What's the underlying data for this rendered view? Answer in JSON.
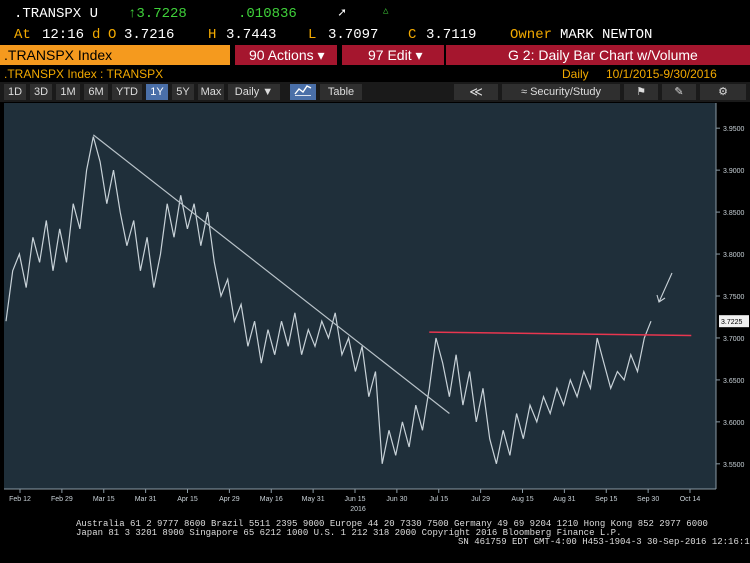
{
  "header": {
    "ticker": ".TRANSPX U",
    "last": "↑3.7228",
    "change": ".010836",
    "at_label": "At",
    "time": "12:16",
    "d_label": "d",
    "open_label": "O",
    "open": "3.7216",
    "high_label": "H",
    "high": "3.7443",
    "low_label": "L",
    "low": "3.7097",
    "close_label": "C",
    "close": "3.7119",
    "owner_label": "Owner",
    "owner": "MARK NEWTON"
  },
  "menubar": {
    "index_label": ".TRANSPX Index",
    "actions_label": "90 Actions ▾",
    "edit_label": "97 Edit ▾",
    "chart_title": "G 2: Daily Bar Chart w/Volume"
  },
  "subheader": {
    "security": ".TRANSPX Index : TRANSPX",
    "period": "Daily",
    "range": "10/1/2015-9/30/2016"
  },
  "toolbar": {
    "ranges": [
      "1D",
      "3D",
      "1M",
      "6M",
      "YTD",
      "1Y",
      "5Y",
      "Max"
    ],
    "active_range": "1Y",
    "frequency": "Daily ▼",
    "table_label": "Table",
    "back_label": "≪",
    "security_study_label": "Security/Study"
  },
  "colors": {
    "chart_bg": "#1f2f3a",
    "price_line": "#c8d2d8",
    "trend_line": "#b9c3c9",
    "resistance_line": "#e8364f",
    "accent_amber": "#f59a1e",
    "menu_red": "#a5162e"
  },
  "chart_data": {
    "type": "line",
    "title": "",
    "xlabel": "",
    "ylabel": "",
    "ylim": [
      3.52,
      3.98
    ],
    "y_ticks": [
      3.55,
      3.6,
      3.65,
      3.7,
      3.75,
      3.8,
      3.85,
      3.9,
      3.95
    ],
    "y_tick_labels": [
      "3.5500",
      "3.6000",
      "3.6500",
      "3.7000",
      "3.7500",
      "3.8000",
      "3.8500",
      "3.9000",
      "3.9500"
    ],
    "last_value_label": "3.7225",
    "x_tick_labels": [
      "Feb 12",
      "Feb 29",
      "Mar 15",
      "Mar 31",
      "Apr 15",
      "Apr 29",
      "May 16",
      "May 31",
      "Jun 15",
      "Jun 30",
      "Jul 15",
      "Jul 29",
      "Aug 15",
      "Aug 31",
      "Sep 15",
      "Sep 30",
      "Oct 14"
    ],
    "year_label": "2016",
    "series": [
      {
        "values": [
          3.72,
          3.78,
          3.8,
          3.76,
          3.82,
          3.79,
          3.84,
          3.78,
          3.83,
          3.79,
          3.86,
          3.83,
          3.9,
          3.94,
          3.91,
          3.86,
          3.9,
          3.85,
          3.81,
          3.84,
          3.78,
          3.82,
          3.76,
          3.8,
          3.86,
          3.82,
          3.87,
          3.83,
          3.86,
          3.81,
          3.85,
          3.79,
          3.75,
          3.77,
          3.72,
          3.74,
          3.69,
          3.72,
          3.67,
          3.71,
          3.68,
          3.72,
          3.69,
          3.73,
          3.68,
          3.71,
          3.69,
          3.72,
          3.7,
          3.73,
          3.68,
          3.7,
          3.66,
          3.69,
          3.63,
          3.66,
          3.55,
          3.59,
          3.56,
          3.6,
          3.57,
          3.62,
          3.59,
          3.64,
          3.7,
          3.67,
          3.63,
          3.68,
          3.62,
          3.66,
          3.6,
          3.64,
          3.58,
          3.55,
          3.59,
          3.56,
          3.61,
          3.58,
          3.62,
          3.6,
          3.63,
          3.61,
          3.64,
          3.62,
          3.65,
          3.63,
          3.66,
          3.64,
          3.7,
          3.67,
          3.64,
          3.66,
          3.65,
          3.68,
          3.66,
          3.7,
          3.72
        ]
      }
    ],
    "annotations": {
      "trendline": {
        "from": {
          "x_index": 13,
          "y": 3.942
        },
        "to": {
          "x_index": 66,
          "y": 3.61
        }
      },
      "resistance": {
        "from": {
          "x_index": 63,
          "y": 3.707
        },
        "to": {
          "x_index": 102,
          "y": 3.703
        }
      },
      "arrow_note": "up-arrow"
    },
    "grid": false,
    "legend": "none"
  },
  "footer": {
    "line1": "Australia 61 2 9777 8600 Brazil 5511 2395 9000 Europe 44 20 7330 7500 Germany 49 69 9204 1210 Hong Kong 852 2977 6000",
    "line2": "Japan 81 3 3201 8900       Singapore 65 6212 1000       U.S. 1 212 318 2000              Copyright 2016 Bloomberg Finance L.P.",
    "line3": "SN 461759 EDT  GMT-4:00 H453-1904-3 30-Sep-2016 12:16:16"
  }
}
